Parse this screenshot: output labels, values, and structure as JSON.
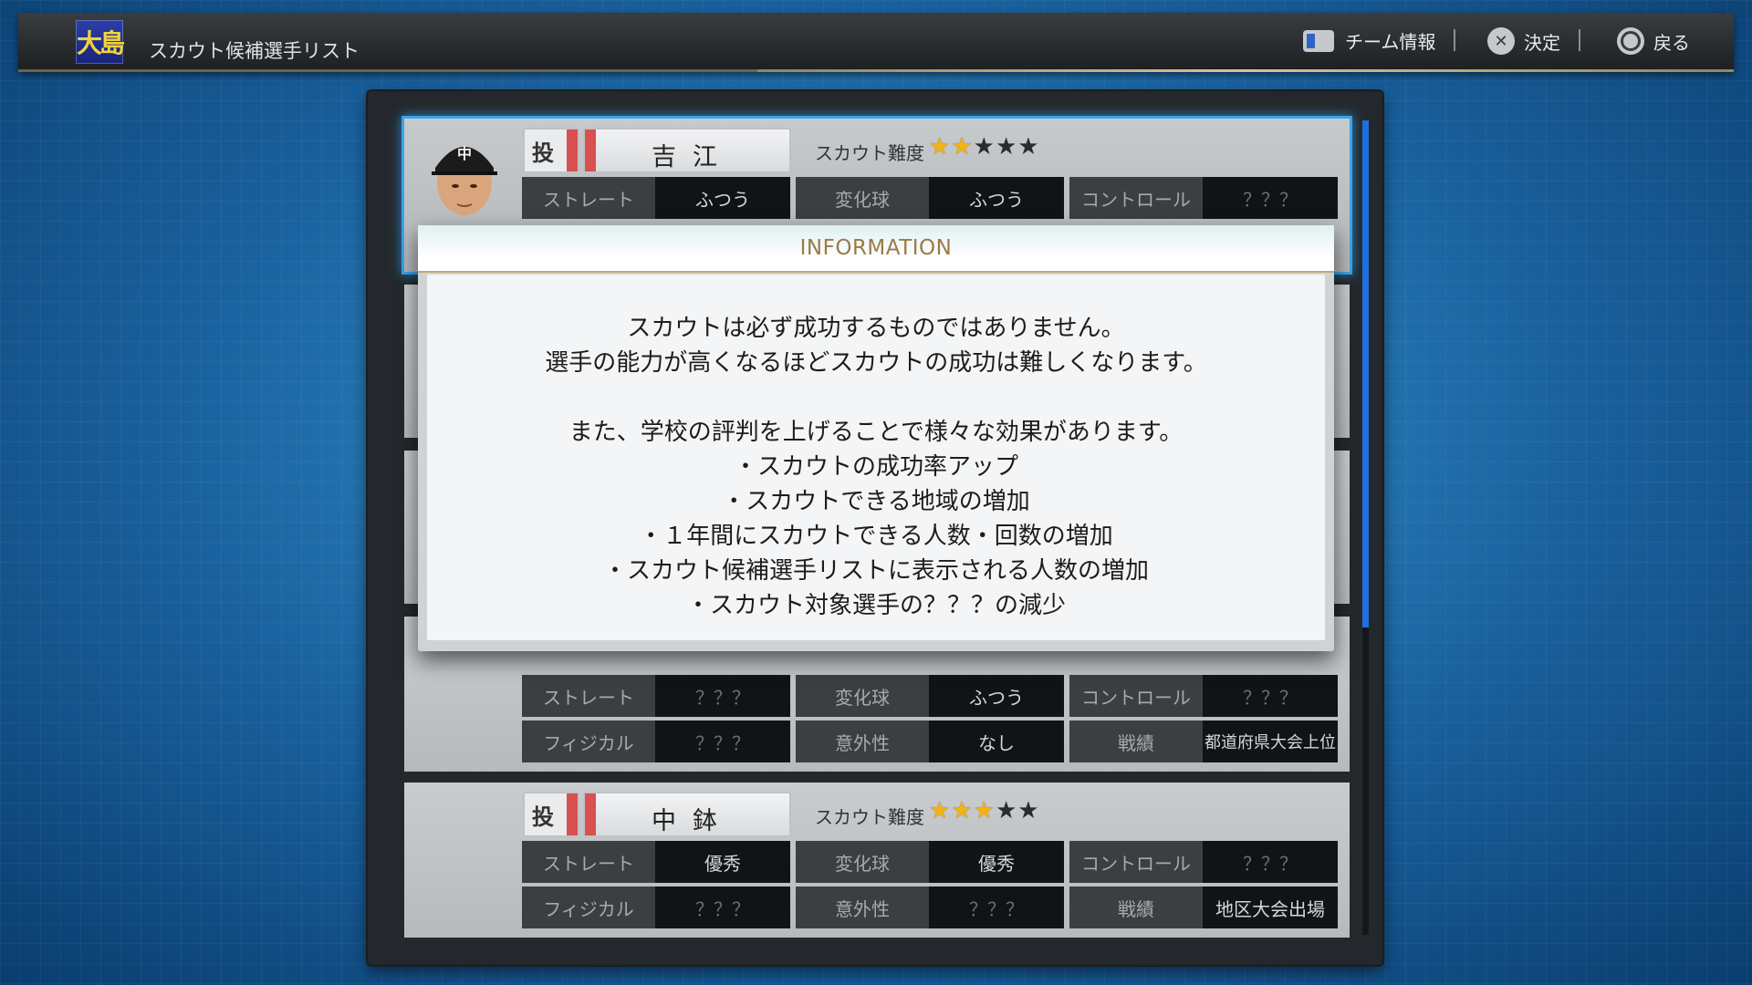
{
  "header": {
    "school_badge": "大島",
    "title": "スカウト候補選手リスト",
    "hints": [
      {
        "icon": "touchpad-icon",
        "label": "チーム情報"
      },
      {
        "icon": "cross-button-icon",
        "label": "決定"
      },
      {
        "icon": "circle-button-icon",
        "label": "戻る"
      }
    ]
  },
  "players": [
    {
      "position": "投",
      "name": "吉江",
      "difficulty_label": "スカウト難度",
      "difficulty_stars": 2,
      "max_stars": 5,
      "row1": [
        {
          "label": "ストレート",
          "value": "ふつう"
        },
        {
          "label": "変化球",
          "value": "ふつう"
        },
        {
          "label": "コントロール",
          "value": "？？？"
        }
      ]
    },
    {
      "row1": [
        {
          "label": "ストレート",
          "value": "？？？"
        },
        {
          "label": "変化球",
          "value": "ふつう"
        },
        {
          "label": "コントロール",
          "value": "？？？"
        }
      ],
      "row2": [
        {
          "label": "フィジカル",
          "value": "？？？"
        },
        {
          "label": "意外性",
          "value": "なし"
        },
        {
          "label": "戦績",
          "value": "都道府県大会上位"
        }
      ]
    },
    {
      "position": "投",
      "name": "中鉢",
      "difficulty_label": "スカウト難度",
      "difficulty_stars": 3,
      "max_stars": 5,
      "row1": [
        {
          "label": "ストレート",
          "value": "優秀"
        },
        {
          "label": "変化球",
          "value": "優秀"
        },
        {
          "label": "コントロール",
          "value": "？？？"
        }
      ],
      "row2": [
        {
          "label": "フィジカル",
          "value": "？？？"
        },
        {
          "label": "意外性",
          "value": "？？？"
        },
        {
          "label": "戦績",
          "value": "地区大会出場"
        }
      ]
    }
  ],
  "dialog": {
    "title": "INFORMATION",
    "lines": [
      "スカウトは必ず成功するものではありません。",
      "選手の能力が高くなるほどスカウトの成功は難しくなります。",
      "",
      "また、学校の評判を上げることで様々な効果があります。",
      "・スカウトの成功率アップ",
      "・スカウトできる地域の増加",
      "・１年間にスカウトできる人数・回数の増加",
      "・スカウト候補選手リストに表示される人数の増加",
      "・スカウト対象選手の？？？の減少"
    ]
  },
  "colors": {
    "selection": "#3aa2ea",
    "star_on": "#f0b418",
    "position_tag": "#d85050",
    "dialog_title": "#9b7a45"
  }
}
